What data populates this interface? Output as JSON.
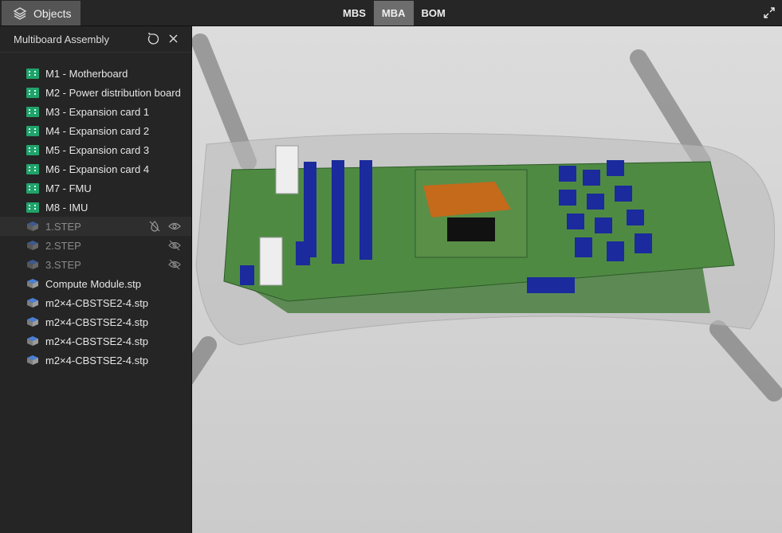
{
  "topbar": {
    "objects_label": "Objects",
    "tabs": [
      {
        "label": "MBS",
        "active": false
      },
      {
        "label": "MBA",
        "active": true
      },
      {
        "label": "BOM",
        "active": false
      }
    ]
  },
  "sidebar": {
    "title": "Multiboard Assembly",
    "items": [
      {
        "label": "M1 - Motherboard",
        "icon": "board-icon"
      },
      {
        "label": "M2 - Power distribution board",
        "icon": "board-icon"
      },
      {
        "label": "M3 - Expansion card 1",
        "icon": "board-icon"
      },
      {
        "label": "M4 - Expansion card 2",
        "icon": "board-icon"
      },
      {
        "label": "M5 - Expansion card 3",
        "icon": "board-icon"
      },
      {
        "label": "M6 - Expansion card 4",
        "icon": "board-icon"
      },
      {
        "label": "M7 - FMU",
        "icon": "board-icon"
      },
      {
        "label": "M8 - IMU",
        "icon": "board-icon"
      },
      {
        "label": "1.STEP",
        "icon": "cube-icon",
        "hidden": true
      },
      {
        "label": "2.STEP",
        "icon": "cube-icon",
        "hidden": true
      },
      {
        "label": "3.STEP",
        "icon": "cube-icon",
        "hidden": true
      },
      {
        "label": "Compute Module.stp",
        "icon": "cube-icon"
      },
      {
        "label": "m2×4-CBSTSE2-4.stp",
        "icon": "cube-icon"
      },
      {
        "label": "m2×4-CBSTSE2-4.stp",
        "icon": "cube-icon"
      },
      {
        "label": "m2×4-CBSTSE2-4.stp",
        "icon": "cube-icon"
      },
      {
        "label": "m2×4-CBSTSE2-4.stp",
        "icon": "cube-icon"
      }
    ]
  },
  "colors": {
    "board_icon": "#20a36a",
    "cube_icon": "#4a7fd6",
    "pcb": "#3f7a3a",
    "component": "#1b2a9c"
  }
}
